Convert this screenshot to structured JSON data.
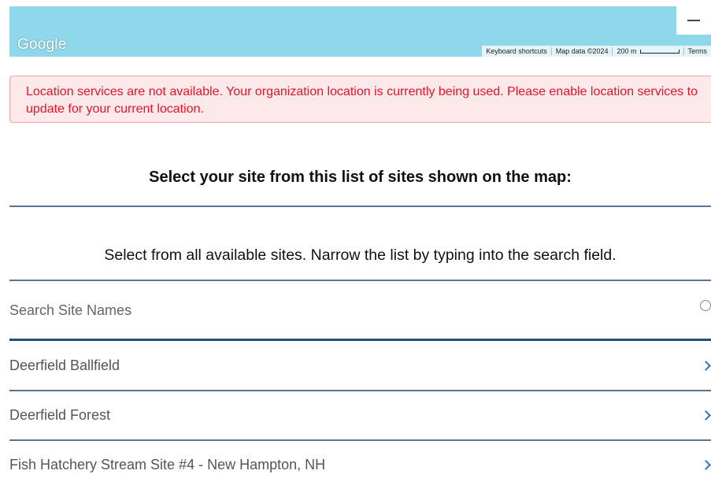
{
  "map": {
    "logo_text": "Google",
    "attribution": {
      "keyboard_shortcuts": "Keyboard shortcuts",
      "map_data": "Map data ©2024",
      "scale": "200 m",
      "terms": "Terms"
    }
  },
  "alert": {
    "message": "Location services are not available. Your organization location is currently being used. Please enable location services to update for your current location."
  },
  "heading": "Select your site from this list of sites shown on the map:",
  "subheading": "Select from all available sites. Narrow the list by typing into the search field.",
  "search": {
    "placeholder": "Search Site Names",
    "value": ""
  },
  "sites": [
    {
      "name": "Deerfield Ballfield"
    },
    {
      "name": "Deerfield Forest"
    },
    {
      "name": "Fish Hatchery Stream Site #4 - New Hampton, NH"
    }
  ],
  "colors": {
    "map_water": "#8fd7ea",
    "alert_text": "#e8132b",
    "alert_bg": "#fde9ea",
    "divider": "#5a7294",
    "search_underline": "#2b4c7b",
    "chevron": "#2a73c9"
  }
}
